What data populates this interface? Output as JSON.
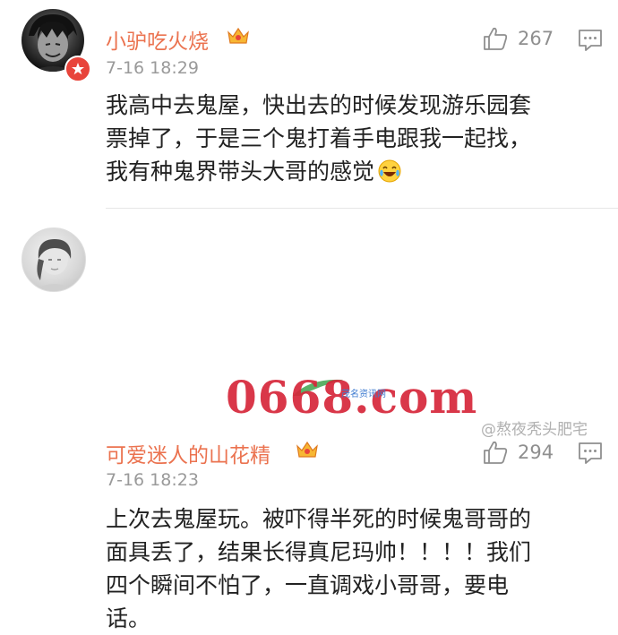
{
  "comments": [
    {
      "username": "小驴吃火烧",
      "time": "7-16 18:29",
      "likes": "267",
      "lines": [
        "我高中去鬼屋，快出去的时候发现游乐园套",
        "票掉了，于是三个鬼打着手电跟我一起找，",
        "我有种鬼界带头大哥的感觉"
      ],
      "avatar_icon": "anime-boy-avatar",
      "badge_icon": "verified-star-badge",
      "crown_icon": "vip-crown-icon",
      "trailing_emoji": "laughing-crying-emoji"
    },
    {
      "username": "可爱迷人的山花精",
      "time": "7-16 18:23",
      "likes": "294",
      "lines": [
        "上次去鬼屋玩。被吓得半死的时候鬼哥哥的",
        "面具丢了，结果长得真尼玛帅！！！！我们",
        "四个瞬间不怕了，一直调戏小哥哥，要电",
        "话。"
      ],
      "avatar_icon": "person-photo-avatar",
      "crown_icon": "vip-crown-icon"
    }
  ],
  "icons": {
    "like": "thumbs-up-icon",
    "reply": "comment-bubble-icon"
  },
  "watermark": {
    "main": "0668.com",
    "sub": "茂名资讯网",
    "handle": "@熬夜秃头肥宅"
  },
  "colors": {
    "username": "#eb7350",
    "time": "#9a9a9a",
    "watermark_red": "#d6273a"
  }
}
